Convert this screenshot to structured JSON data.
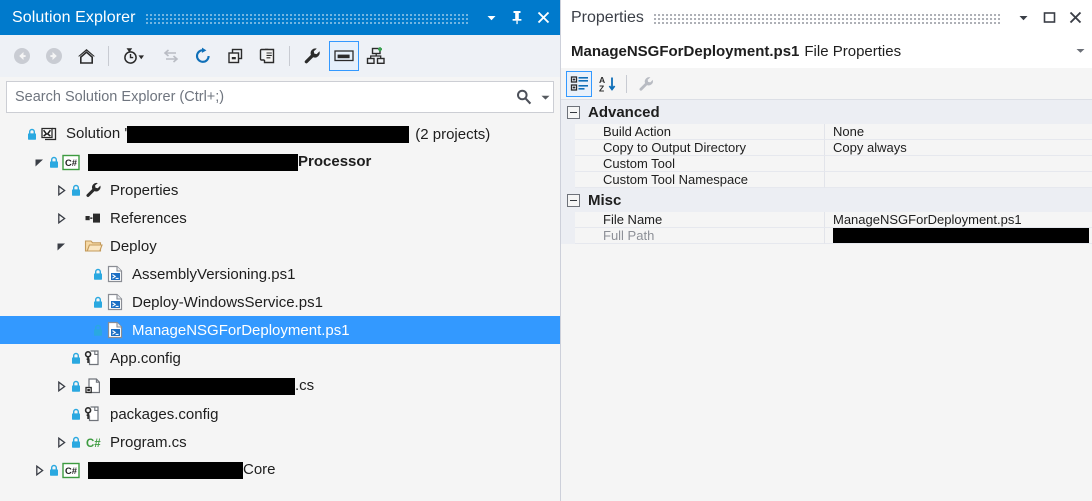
{
  "solution_explorer": {
    "title": "Solution Explorer",
    "title_buttons": [
      {
        "name": "window-menu-dropdown",
        "glyph": "chevron-down-icon"
      },
      {
        "name": "auto-hide-pin",
        "glyph": "pin-icon"
      },
      {
        "name": "close-panel",
        "glyph": "close-icon"
      }
    ],
    "toolbar": [
      {
        "name": "back-button",
        "icon": "back-arrow-icon",
        "enabled": false
      },
      {
        "name": "forward-button",
        "icon": "forward-arrow-icon",
        "enabled": false
      },
      {
        "name": "home-button",
        "icon": "home-icon",
        "enabled": true
      },
      {
        "name": "pending-changes-filter-button",
        "icon": "clock-filter-icon",
        "enabled": true
      },
      {
        "name": "sync-with-active-document-button",
        "icon": "sync-arrows-icon",
        "enabled": false
      },
      {
        "name": "refresh-button",
        "icon": "refresh-icon",
        "enabled": true
      },
      {
        "name": "collapse-all-button",
        "icon": "collapse-all-icon",
        "enabled": true
      },
      {
        "name": "show-all-files-button",
        "icon": "show-all-files-icon",
        "enabled": true
      },
      {
        "name": "properties-button",
        "icon": "wrench-icon",
        "enabled": true
      },
      {
        "name": "preview-selected-items-button",
        "icon": "preview-window-icon",
        "enabled": true,
        "checked": true
      },
      {
        "name": "view-class-diagram-button",
        "icon": "class-diagram-icon",
        "enabled": true
      }
    ],
    "search": {
      "placeholder": "Search Solution Explorer (Ctrl+;)",
      "value": ""
    },
    "tree": [
      {
        "id": "solution-root",
        "depth": 0,
        "expander": "none",
        "lock": true,
        "icon": "solution-icon",
        "prefix": "Solution '",
        "redacted_width": 282,
        "suffix": "",
        "trailing": "(2 projects)",
        "bold": false,
        "selected": false
      },
      {
        "id": "project-processor",
        "depth": 1,
        "expander": "expanded",
        "lock": true,
        "icon": "csharp-project-icon",
        "prefix": "",
        "redacted_width": 210,
        "suffix": "Processor",
        "trailing": "",
        "bold": true,
        "selected": false
      },
      {
        "id": "properties-folder",
        "depth": 2,
        "expander": "collapsed",
        "lock": true,
        "icon": "wrench-icon",
        "prefix": "",
        "redacted_width": 0,
        "suffix": "Properties",
        "trailing": "",
        "bold": false,
        "selected": false
      },
      {
        "id": "references-folder",
        "depth": 2,
        "expander": "collapsed",
        "lock": false,
        "icon": "references-icon",
        "prefix": "",
        "redacted_width": 0,
        "suffix": "References",
        "trailing": "",
        "bold": false,
        "selected": false
      },
      {
        "id": "deploy-folder",
        "depth": 2,
        "expander": "expanded",
        "lock": false,
        "icon": "folder-open-icon",
        "prefix": "",
        "redacted_width": 0,
        "suffix": "Deploy",
        "trailing": "",
        "bold": false,
        "selected": false
      },
      {
        "id": "file-assemblyversioning",
        "depth": 3,
        "expander": "none",
        "lock": true,
        "icon": "powershell-file-icon",
        "prefix": "",
        "redacted_width": 0,
        "suffix": "AssemblyVersioning.ps1",
        "trailing": "",
        "bold": false,
        "selected": false
      },
      {
        "id": "file-deploy-windowsservice",
        "depth": 3,
        "expander": "none",
        "lock": true,
        "icon": "powershell-file-icon",
        "prefix": "",
        "redacted_width": 0,
        "suffix": "Deploy-WindowsService.ps1",
        "trailing": "",
        "bold": false,
        "selected": false
      },
      {
        "id": "file-managensgfordeployment",
        "depth": 3,
        "expander": "none",
        "lock": true,
        "icon": "powershell-file-icon",
        "prefix": "",
        "redacted_width": 0,
        "suffix": "ManageNSGForDeployment.ps1",
        "trailing": "",
        "bold": false,
        "selected": true
      },
      {
        "id": "file-app-config",
        "depth": 2,
        "expander": "none",
        "lock": true,
        "icon": "config-file-icon",
        "prefix": "",
        "redacted_width": 0,
        "suffix": "App.config",
        "trailing": "",
        "bold": false,
        "selected": false
      },
      {
        "id": "file-redacted-cs",
        "depth": 2,
        "expander": "collapsed",
        "lock": true,
        "icon": "component-file-icon",
        "prefix": "",
        "redacted_width": 185,
        "suffix": ".cs",
        "trailing": "",
        "bold": false,
        "selected": false
      },
      {
        "id": "file-packages-config",
        "depth": 2,
        "expander": "none",
        "lock": true,
        "icon": "config-file-icon",
        "prefix": "",
        "redacted_width": 0,
        "suffix": "packages.config",
        "trailing": "",
        "bold": false,
        "selected": false
      },
      {
        "id": "file-program-cs",
        "depth": 2,
        "expander": "collapsed",
        "lock": true,
        "icon": "csharp-file-icon",
        "prefix": "",
        "redacted_width": 0,
        "suffix": "Program.cs",
        "trailing": "",
        "bold": false,
        "selected": false
      },
      {
        "id": "project-core",
        "depth": 1,
        "expander": "collapsed",
        "lock": true,
        "icon": "csharp-project-icon",
        "prefix": "",
        "redacted_width": 155,
        "suffix": "Core",
        "trailing": "",
        "bold": false,
        "selected": false
      }
    ]
  },
  "properties": {
    "title": "Properties",
    "title_buttons": [
      {
        "name": "window-menu-dropdown",
        "glyph": "chevron-down-icon"
      },
      {
        "name": "maximize-panel",
        "glyph": "maximize-icon"
      },
      {
        "name": "close-panel",
        "glyph": "close-icon"
      }
    ],
    "object": {
      "name": "ManageNSGForDeployment.ps1",
      "type": "File Properties",
      "dropdown": "chevron-down-icon"
    },
    "toolbar": [
      {
        "name": "categorized-view-button",
        "icon": "categorized-icon",
        "checked": true
      },
      {
        "name": "alphabetical-view-button",
        "icon": "sort-az-icon",
        "checked": false
      },
      {
        "name": "property-pages-button",
        "icon": "wrench-icon",
        "checked": false,
        "enabled": false
      }
    ],
    "groups": [
      {
        "name": "Advanced",
        "expanded": true,
        "rows": [
          {
            "name": "Build Action",
            "value": "None",
            "readonly": false,
            "redacted_width": 0
          },
          {
            "name": "Copy to Output Directory",
            "value": "Copy always",
            "readonly": false,
            "redacted_width": 0
          },
          {
            "name": "Custom Tool",
            "value": "",
            "readonly": false,
            "redacted_width": 0
          },
          {
            "name": "Custom Tool Namespace",
            "value": "",
            "readonly": false,
            "redacted_width": 0
          }
        ]
      },
      {
        "name": "Misc",
        "expanded": true,
        "rows": [
          {
            "name": "File Name",
            "value": "ManageNSGForDeployment.ps1",
            "readonly": false,
            "redacted_width": 0
          },
          {
            "name": "Full Path",
            "value": "",
            "readonly": true,
            "redacted_width": 256
          }
        ]
      }
    ]
  },
  "colors": {
    "title_active_bg": "#007acc",
    "title_inactive_bg": "#ffffff",
    "selection_bg": "#3399ff",
    "panel_bg": "#f5f5f5",
    "toolbar_bg": "#eef1f6",
    "category_bg": "#eceef3",
    "accent_border": "#3399ff"
  }
}
